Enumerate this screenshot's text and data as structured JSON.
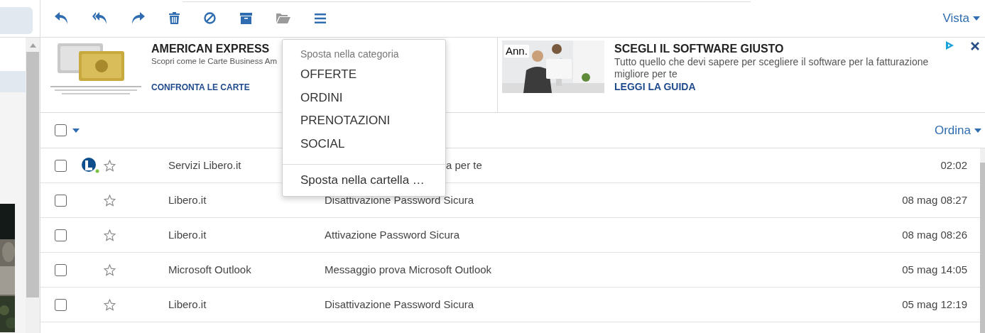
{
  "toolbar": {
    "view_menu": "Vista"
  },
  "ads": [
    {
      "kind": "cards",
      "title": "AMERICAN EXPRESS",
      "text": "Scopri come le Carte Business Am",
      "link": "CONFRONTA LE CARTE"
    },
    {
      "badge": "Ann.",
      "title": "SCEGLI IL SOFTWARE GIUSTO",
      "text": "Tutto quello che devi sapere per scegliere il software per la fatturazione migliore per te",
      "link": "LEGGI LA GUIDA"
    }
  ],
  "list_header": {
    "select_all_checked": false,
    "sort_menu": "Ordina"
  },
  "messages": [
    {
      "checked": false,
      "avatar": true,
      "starred": false,
      "sender": "Servizi Libero.it",
      "subject": "a per te",
      "subject_covered": true,
      "time": "02:02"
    },
    {
      "checked": false,
      "avatar": false,
      "starred": false,
      "sender": "Libero.it",
      "subject": "Disattivazione Password Sicura",
      "subject_covered": false,
      "time": "08 mag 08:27"
    },
    {
      "checked": false,
      "avatar": false,
      "starred": false,
      "sender": "Libero.it",
      "subject": "Attivazione Password Sicura",
      "subject_covered": false,
      "time": "08 mag 08:26"
    },
    {
      "checked": false,
      "avatar": false,
      "starred": false,
      "sender": "Microsoft Outlook",
      "subject": "Messaggio prova Microsoft Outlook",
      "subject_covered": false,
      "time": "05 mag 14:05"
    },
    {
      "checked": false,
      "avatar": false,
      "starred": false,
      "sender": "Libero.it",
      "subject": "Disattivazione Password Sicura",
      "subject_covered": false,
      "time": "05 mag 12:19"
    }
  ],
  "move_menu": {
    "header": "Sposta nella categoria",
    "items": [
      "OFFERTE",
      "ORDINI",
      "PRENOTAZIONI",
      "SOCIAL"
    ],
    "footer": "Sposta nella cartella …"
  }
}
